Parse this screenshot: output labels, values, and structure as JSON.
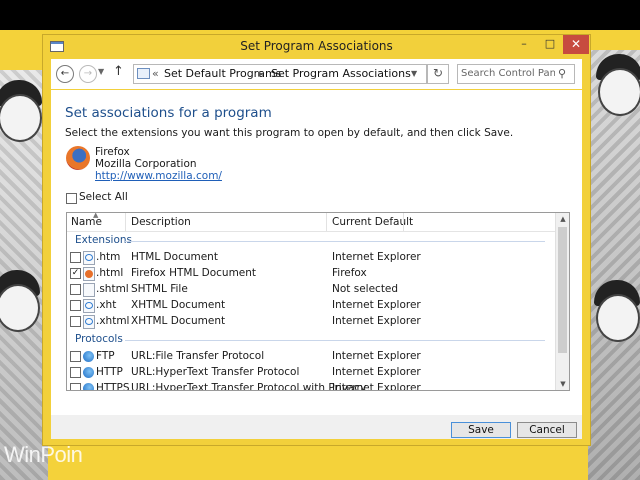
{
  "window": {
    "title": "Set Program Associations"
  },
  "address": {
    "separator": "«",
    "breadcrumbs": [
      "Set Default Programs",
      "Set Program Associations"
    ],
    "arrow": "▸",
    "search_placeholder": "Search Control Panel"
  },
  "content": {
    "heading": "Set associations for a program",
    "instructions": "Select the extensions you want this program to open by default, and then click Save.",
    "program": {
      "name": "Firefox",
      "company": "Mozilla Corporation",
      "url": "http://www.mozilla.com/"
    },
    "select_all_label": "Select All"
  },
  "table": {
    "columns": [
      "Name",
      "Description",
      "Current Default"
    ],
    "groups": [
      {
        "label": "Extensions",
        "rows": [
          {
            "name": ".htm",
            "description": "HTML Document",
            "default": "Internet Explorer",
            "checked": false,
            "icon": "ie-document-icon"
          },
          {
            "name": ".html",
            "description": "Firefox HTML Document",
            "default": "Firefox",
            "checked": true,
            "icon": "firefox-document-icon"
          },
          {
            "name": ".shtml",
            "description": "SHTML File",
            "default": "Not selected",
            "checked": false,
            "icon": "blank-document-icon"
          },
          {
            "name": ".xht",
            "description": "XHTML Document",
            "default": "Internet Explorer",
            "checked": false,
            "icon": "ie-document-icon"
          },
          {
            "name": ".xhtml",
            "description": "XHTML Document",
            "default": "Internet Explorer",
            "checked": false,
            "icon": "ie-document-icon"
          }
        ]
      },
      {
        "label": "Protocols",
        "rows": [
          {
            "name": "FTP",
            "description": "URL:File Transfer Protocol",
            "default": "Internet Explorer",
            "checked": false,
            "icon": "ie-protocol-icon"
          },
          {
            "name": "HTTP",
            "description": "URL:HyperText Transfer Protocol",
            "default": "Internet Explorer",
            "checked": false,
            "icon": "ie-protocol-icon"
          },
          {
            "name": "HTTPS",
            "description": "URL:HyperText Transfer Protocol with Privacy",
            "default": "Internet Explorer",
            "checked": false,
            "icon": "ie-protocol-icon"
          }
        ]
      }
    ]
  },
  "buttons": {
    "save": "Save",
    "cancel": "Cancel"
  },
  "watermark": "WinPoin"
}
